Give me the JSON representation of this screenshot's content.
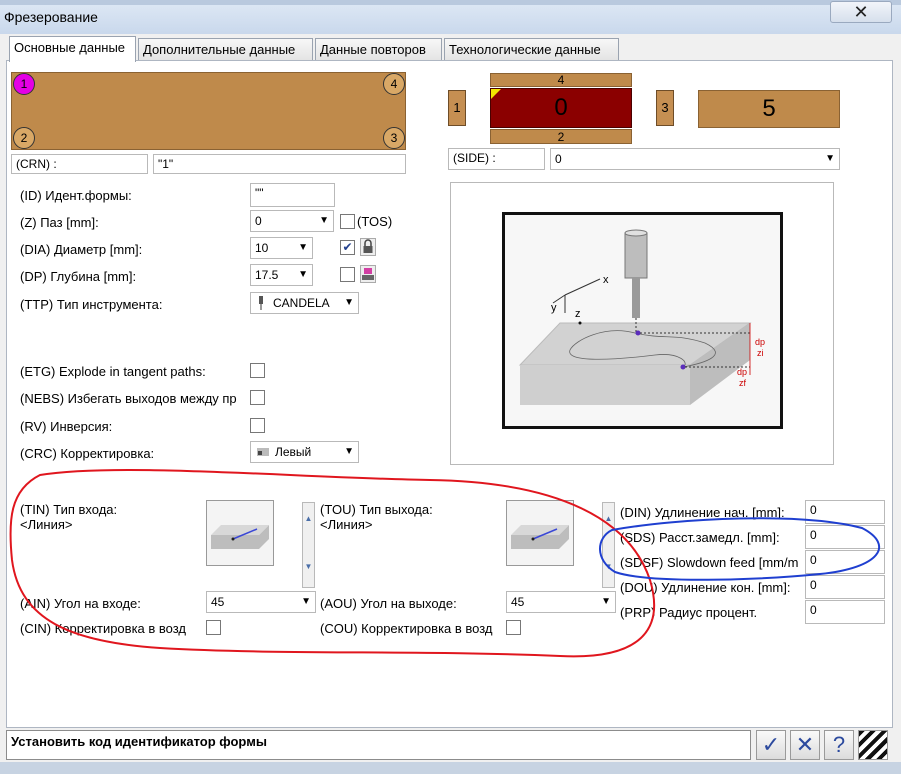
{
  "window": {
    "title": "Фрезерование",
    "close_glyph": "✕"
  },
  "tabs": [
    {
      "label": "Основные данные"
    },
    {
      "label": "Дополнительные данные"
    },
    {
      "label": "Данные повторов"
    },
    {
      "label": "Технологические данные"
    }
  ],
  "corners": [
    "1",
    "2",
    "3",
    "4"
  ],
  "crn": {
    "label": "(CRN) :",
    "value": "\"1\""
  },
  "sides": {
    "top": "4",
    "left": "1",
    "center": "0",
    "right_num": "3",
    "right_value": "5",
    "bottom": "2"
  },
  "side_field": {
    "label": "(SIDE) :",
    "value": "0"
  },
  "fields": {
    "id": {
      "label": "(ID) Идент.формы:",
      "value": "\"\""
    },
    "z": {
      "label": "(Z) Паз [mm]:",
      "value": "0",
      "check_label": "(TOS)"
    },
    "dia": {
      "label": "(DIA) Диаметр [mm]:",
      "value": "10"
    },
    "dp": {
      "label": "(DP) Глубина [mm]:",
      "value": "17.5"
    },
    "ttp": {
      "label": "(TTP) Тип инструмента:",
      "value": "CANDELA"
    },
    "etg": {
      "label": "(ETG) Explode in tangent paths:"
    },
    "nebs": {
      "label": "(NEBS) Избегать выходов между пр"
    },
    "rv": {
      "label": "(RV) Инверсия:"
    },
    "crc": {
      "label": "(CRC) Корректировка:",
      "value": "Левый"
    }
  },
  "diagram": {
    "labels": {
      "x": "x",
      "y": "y",
      "z": "z",
      "dp1": "dp",
      "zi": "zi",
      "dp2": "dp",
      "zf": "zf"
    }
  },
  "entry": {
    "tin_label": "(TIN) Тип входа:",
    "tin_value": "<Линия>",
    "tou_label": "(TOU) Тип выхода:",
    "tou_value": "<Линия>",
    "ain_label": "(AIN) Угол на входе:",
    "ain_value": "45",
    "aou_label": "(AOU) Угол на выходе:",
    "aou_value": "45",
    "cin_label": "(CIN) Корректировка в возд",
    "cou_label": "(COU) Корректировка в возд"
  },
  "right_fields": [
    {
      "label": "(DIN) Удлинение нач. [mm]:",
      "value": "0"
    },
    {
      "label": "(SDS) Расст.замедл. [mm]:",
      "value": "0"
    },
    {
      "label": "(SDSF) Slowdown feed [mm/m",
      "value": "0"
    },
    {
      "label": "(DOU) Удлинение кон. [mm]:",
      "value": "0"
    },
    {
      "label": "(PRP) Радиус процент.",
      "value": "0"
    }
  ],
  "status": {
    "text": "Установить код идентификатор формы"
  },
  "toolbar": {
    "ok_glyph": "✓",
    "cancel_glyph": "✕",
    "help_glyph": "?"
  },
  "colors": {
    "wood": "#bf8a4b",
    "center_side": "#8b0000",
    "annotation_red": "#e0161e",
    "annotation_blue": "#1f3fd0",
    "selected_corner": "#e400e4"
  }
}
